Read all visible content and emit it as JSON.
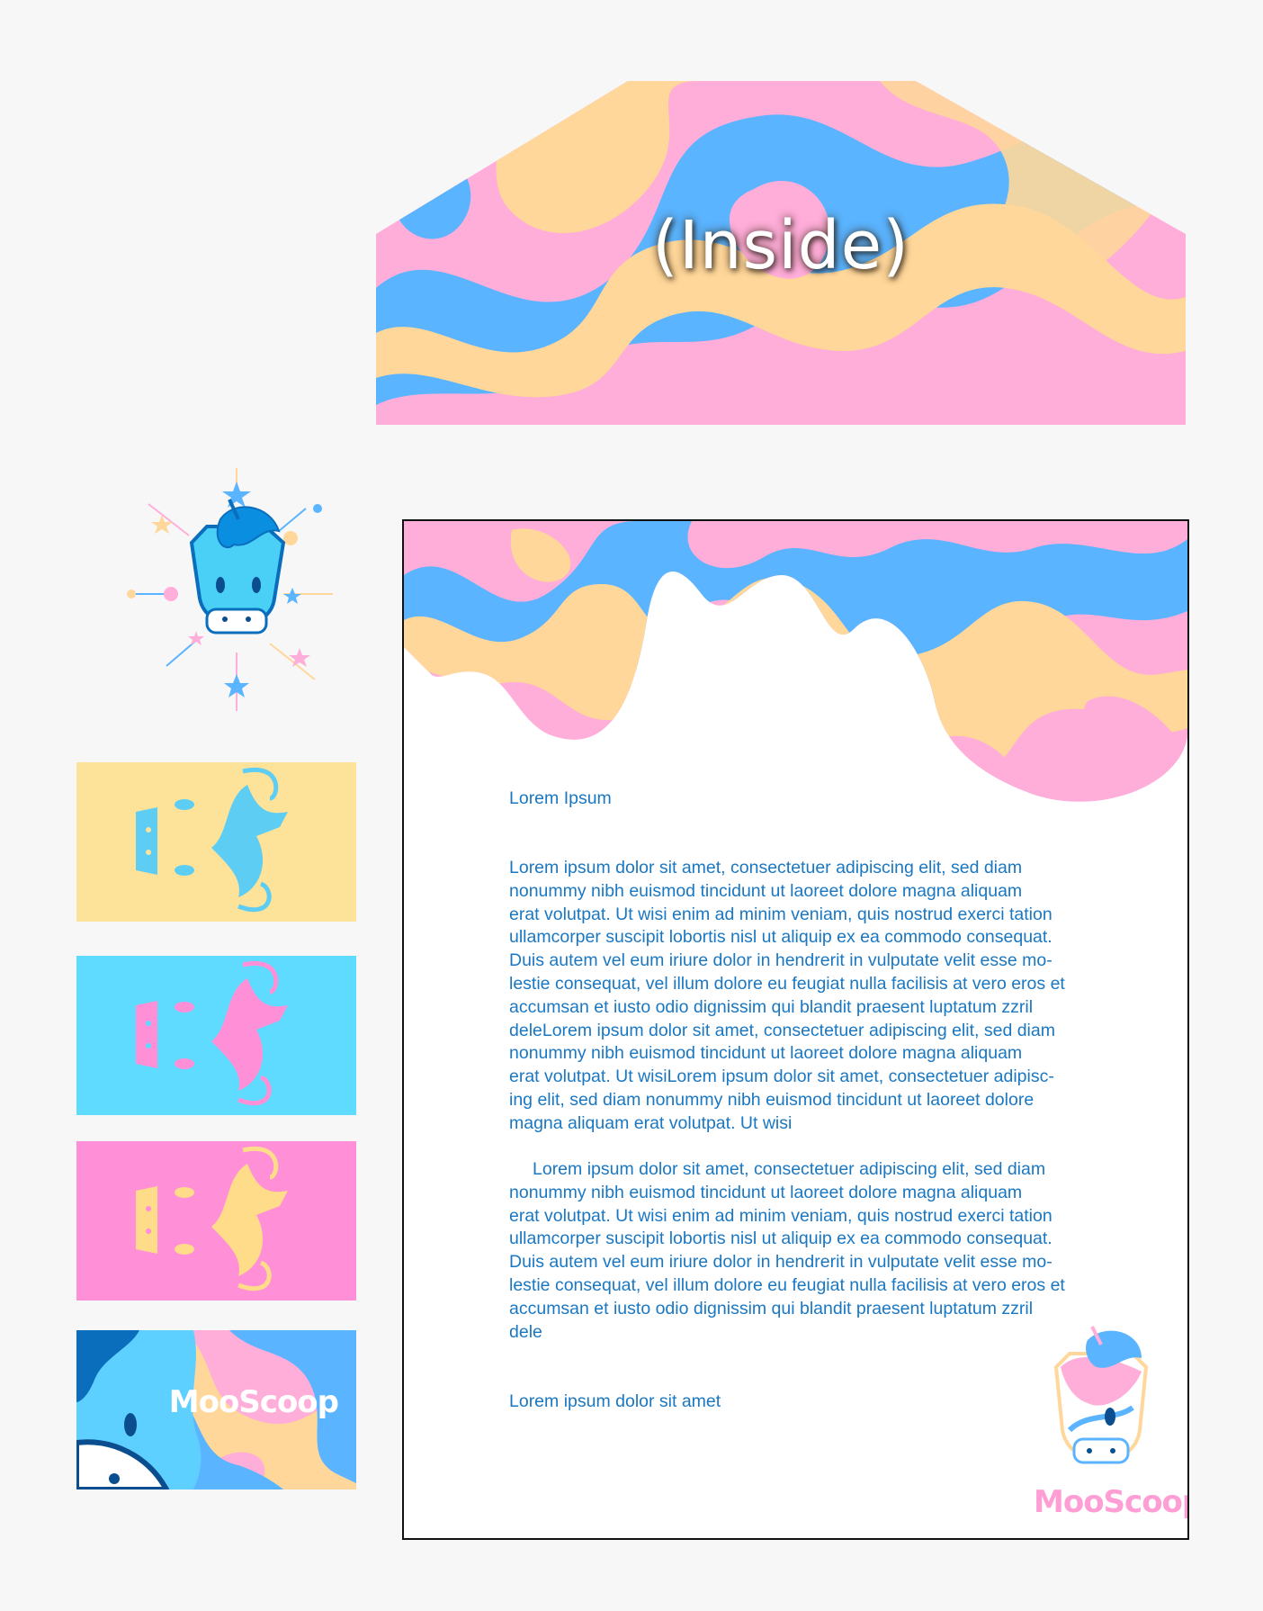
{
  "envelope": {
    "label": "(Inside)"
  },
  "brand": {
    "name": "MooScoop",
    "colors": {
      "pink": "#ffadd9",
      "blue": "#5ab4ff",
      "yellow": "#ffd79a",
      "text": "#1a77c2"
    }
  },
  "cards": [
    {
      "background": "#fde39a",
      "mark": "#5ecdf4"
    },
    {
      "background": "#5edbff",
      "mark": "#ff8fd6"
    },
    {
      "background": "#ff8fd6",
      "mark": "#ffdc8a"
    },
    {
      "background": "marble",
      "logo": "MooScoop"
    }
  ],
  "letter": {
    "heading": "Lorem Ipsum",
    "paragraph_1": "Lorem ipsum dolor sit amet, consectetuer adipiscing elit, sed diam\nnonummy nibh euismod tincidunt ut laoreet dolore magna aliquam\nerat volutpat. Ut wisi enim ad minim veniam, quis nostrud exerci tation\nullamcorper suscipit lobortis nisl ut aliquip ex ea commodo consequat.\nDuis autem vel eum iriure dolor in hendrerit in vulputate velit esse mo-\nlestie consequat, vel illum dolore eu feugiat nulla facilisis at vero eros et\naccumsan et iusto odio dignissim qui blandit praesent luptatum zzril\ndeleLorem ipsum dolor sit amet, consectetuer adipiscing elit, sed diam\nnonummy nibh euismod tincidunt ut laoreet dolore magna aliquam\nerat volutpat. Ut wisiLorem ipsum dolor sit amet, consectetuer adipisc-\ning elit, sed diam nonummy nibh euismod tincidunt ut laoreet dolore\nmagna aliquam erat volutpat. Ut wisi",
    "paragraph_2": "Lorem ipsum dolor sit amet, consectetuer adipiscing elit, sed diam\nnonummy nibh euismod tincidunt ut laoreet dolore magna aliquam\nerat volutpat. Ut wisi enim ad minim veniam, quis nostrud exerci tation\nullamcorper suscipit lobortis nisl ut aliquip ex ea commodo consequat.\nDuis autem vel eum iriure dolor in hendrerit in vulputate velit esse mo-\nlestie consequat, vel illum dolore eu feugiat nulla facilisis at vero eros et\naccumsan et iusto odio dignissim qui blandit praesent luptatum zzril\ndele",
    "signoff": "Lorem ipsum dolor sit amet",
    "logo": "MooScoop"
  },
  "icons": [
    "unicorn-head-icon",
    "star-icon",
    "sunburst-icon"
  ]
}
